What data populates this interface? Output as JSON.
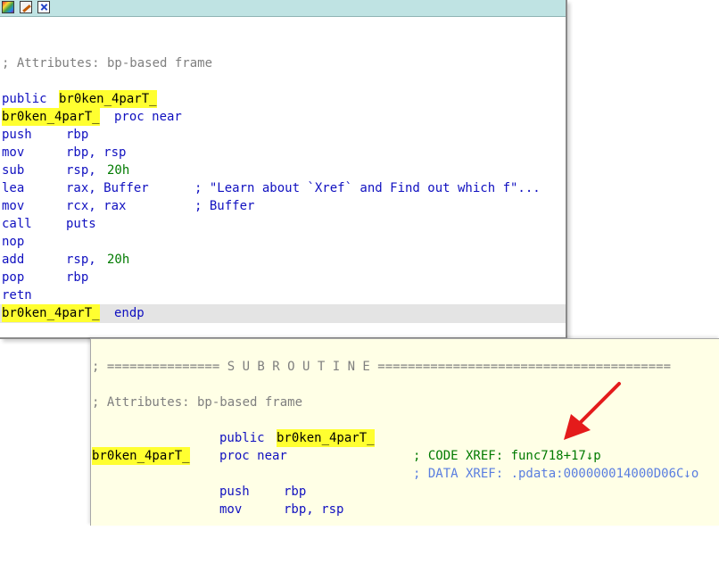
{
  "window1": {
    "toolbar_icons": [
      "graph-overview-icon",
      "edit-icon",
      "close-window-icon"
    ],
    "lines": {
      "attributes_comment": "; Attributes: bp-based frame",
      "public_kw": "public",
      "func_name": "br0ken_4parT_",
      "proc_kw": "proc near",
      "i1": {
        "op": "push",
        "a": "rbp"
      },
      "i2": {
        "op": "mov",
        "a": "rbp, rsp"
      },
      "i3": {
        "op": "sub",
        "a": "rsp, ",
        "n": "20h"
      },
      "i4": {
        "op": "lea",
        "a": "rax, Buffer",
        "c": "; \"Learn about `Xref` and Find out which f\"..."
      },
      "i5": {
        "op": "mov",
        "a": "rcx, rax",
        "c": "; Buffer"
      },
      "i6": {
        "op": "call",
        "a": "puts"
      },
      "i7": {
        "op": "nop"
      },
      "i8": {
        "op": "add",
        "a": "rsp, ",
        "n": "20h"
      },
      "i9": {
        "op": "pop",
        "a": "rbp"
      },
      "i10": {
        "op": "retn"
      },
      "endp_kw": "endp"
    }
  },
  "window2": {
    "subroutine_banner": "; =============== S U B R O U T I N E =======================================",
    "attributes_comment": "; Attributes: bp-based frame",
    "public_kw": "public",
    "func_name": "br0ken_4parT_",
    "proc_kw": "proc near",
    "code_xref": "; CODE XREF: func718+17↓p",
    "data_xref": "; DATA XREF: .pdata:000000014000D06C↓o",
    "i1": {
      "op": "push",
      "a": "rbp"
    },
    "i2": {
      "op": "mov",
      "a": "rbp, rsp"
    }
  },
  "colors": {
    "highlight": "#ffff30",
    "instruction": "#1010c0",
    "number": "#007a00",
    "comment": "#7f7f7f",
    "hint_background": "#ffffe6",
    "annotation_arrow": "#e41b1b"
  }
}
